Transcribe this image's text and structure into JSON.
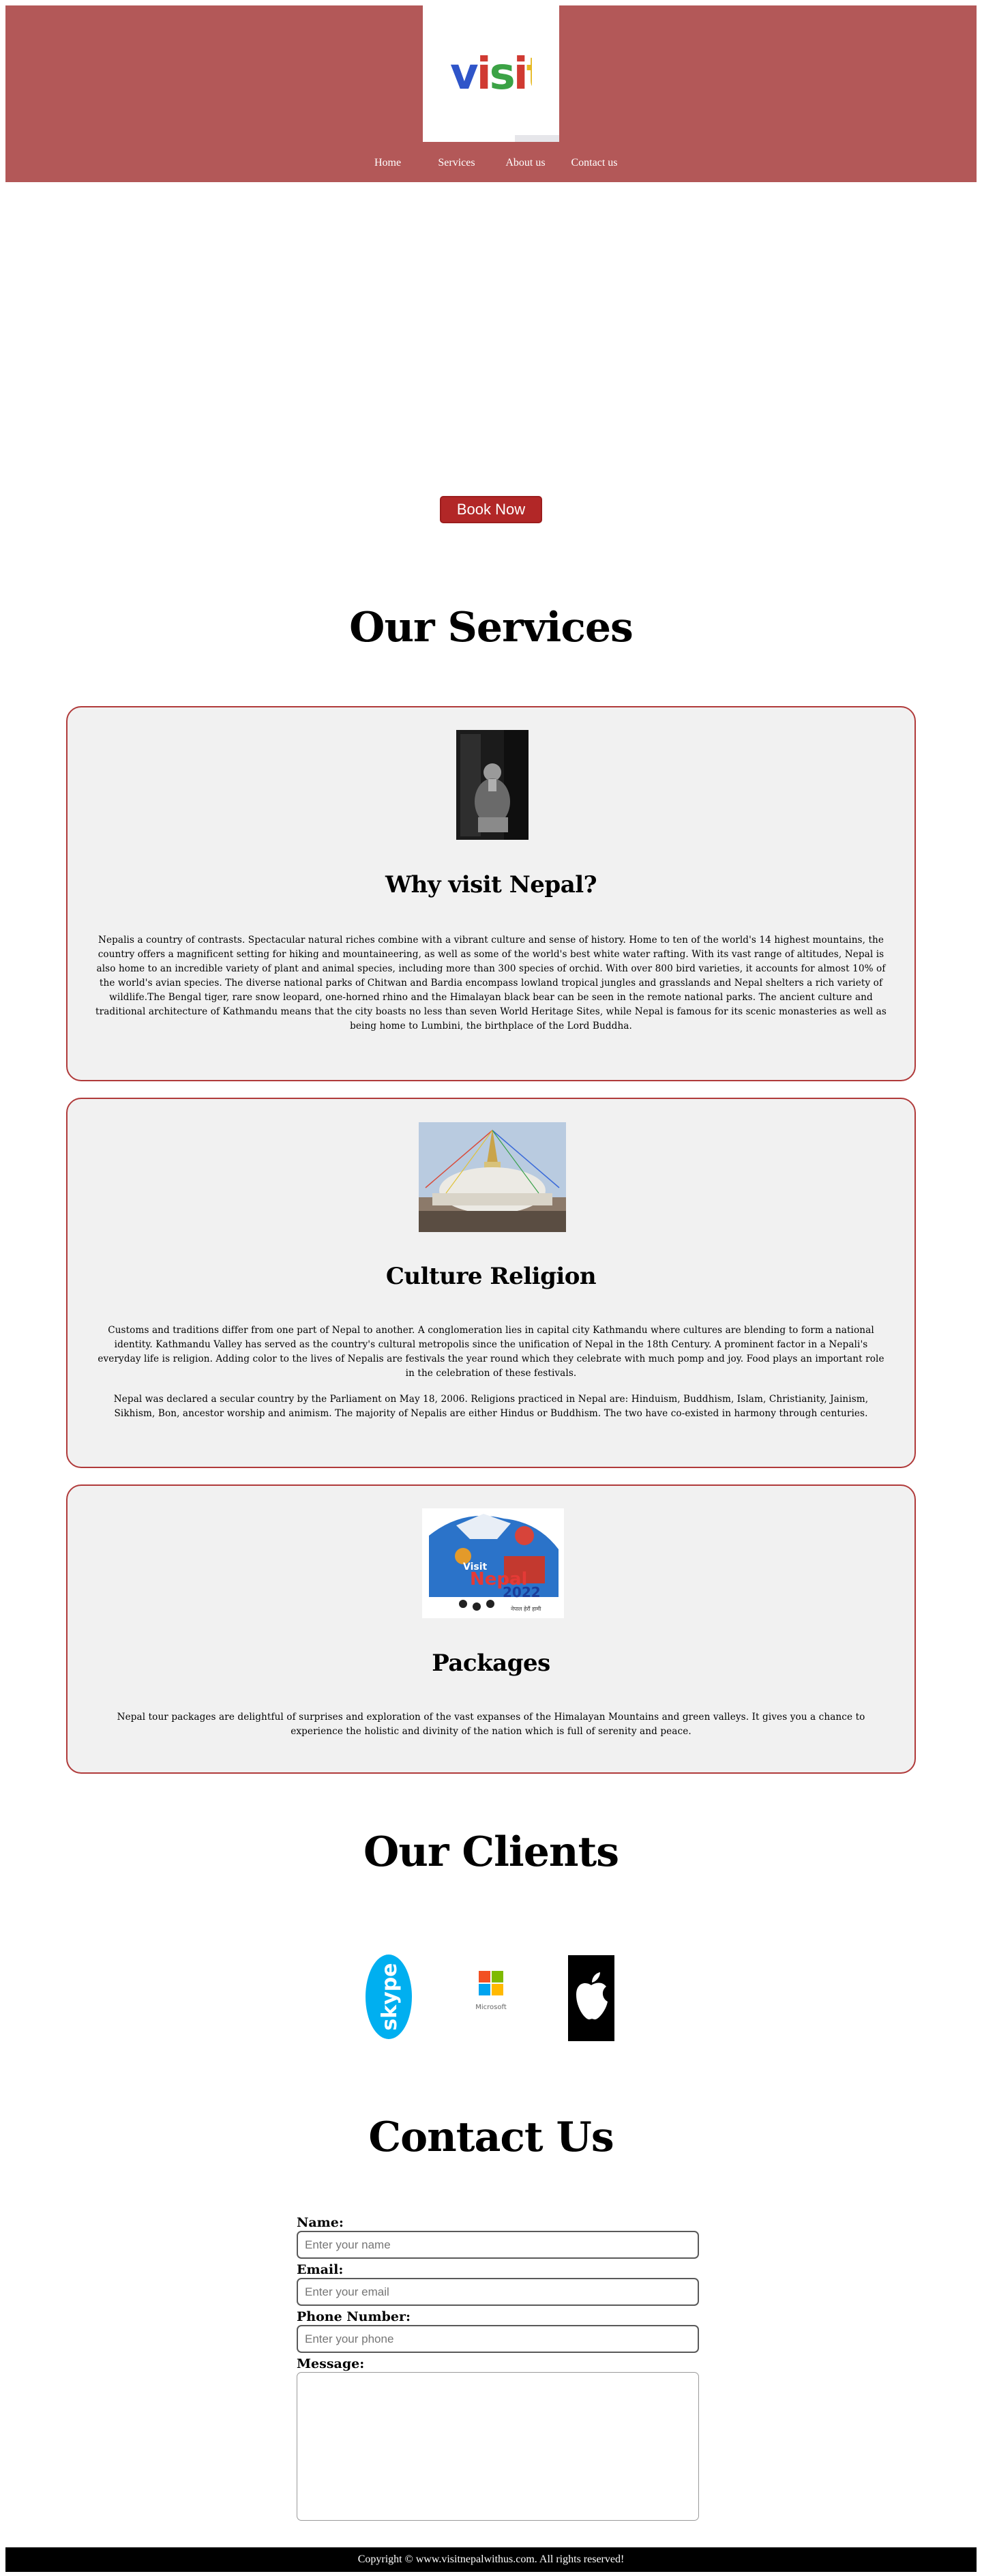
{
  "header": {
    "logo_text": "visit",
    "nav": [
      "Home",
      "Services",
      "About us",
      "Contact us"
    ]
  },
  "hero": {
    "book_label": "Book Now"
  },
  "services": {
    "title": "Our Services",
    "cards": [
      {
        "title": "Why visit Nepal?",
        "paragraphs": [
          "Nepalis a country of contrasts. Spectacular natural riches combine with a vibrant culture and sense of history. Home to ten of the world's 14 highest mountains, the country offers a magnificent setting for hiking and mountaineering, as well as some of the world's best white water rafting. With its vast range of altitudes, Nepal is also home to an incredible variety of plant and animal species, including more than 300 species of orchid. With over 800 bird varieties, it accounts for almost 10% of the world's avian species. The diverse national parks of Chitwan and Bardia encompass lowland tropical jungles and grasslands and Nepal shelters a rich variety of wildlife.The Bengal tiger, rare snow leopard, one-horned rhino and the Himalayan black bear can be seen in the remote national parks. The ancient culture and traditional architecture of Kathmandu means that the city boasts no less than seven World Heritage Sites, while Nepal is famous for its scenic monasteries as well as being home to Lumbini, the birthplace of the Lord Buddha."
        ]
      },
      {
        "title": "Culture Religion",
        "paragraphs": [
          "Customs and traditions differ from one part of Nepal to another. A conglomeration lies in capital city Kathmandu where cultures are blending to form a national identity. Kathmandu Valley has served as the country's cultural metropolis since the unification of Nepal in the 18th Century. A prominent factor in a Nepali's everyday life is religion. Adding color to the lives of Nepalis are festivals the year round which they celebrate with much pomp and joy. Food plays an important role in the celebration of these festivals.",
          "Nepal was declared a secular country by the Parliament on May 18, 2006. Religions practiced in Nepal are: Hinduism, Buddhism, Islam, Christianity, Jainism, Sikhism, Bon, ancestor worship and animism. The majority of Nepalis are either Hindus or Buddhism. The two have co-existed in harmony through centuries."
        ]
      },
      {
        "title": "Packages",
        "poster": {
          "top": "Visit",
          "middle": "Nepal",
          "year": "2022",
          "tagline": "नेपाल हेरौं हामी"
        },
        "paragraphs": [
          "Nepal tour packages are delightful of surprises and exploration of the vast expanses of the Himalayan Mountains and green valleys. It gives you a chance to experience the holistic and divinity of the nation which is full of serenity and peace."
        ]
      }
    ]
  },
  "clients": {
    "title": "Our Clients",
    "logos": [
      {
        "name": "skype-logo",
        "text": "skype",
        "color": "#00aff0"
      },
      {
        "name": "microsoft-logo",
        "text": "Microsoft",
        "colors": [
          "#f25022",
          "#7fba00",
          "#00a4ef",
          "#ffb900"
        ]
      },
      {
        "name": "apple-logo",
        "color": "#000000"
      }
    ]
  },
  "contact": {
    "title": "Contact Us",
    "name_label": "Name:",
    "name_placeholder": "Enter your name",
    "email_label": "Email:",
    "email_placeholder": "Enter your email",
    "phone_label": "Phone Number:",
    "phone_placeholder": "Enter your phone",
    "message_label": "Message:"
  },
  "footer": {
    "text": "Copyright © www.visitnepalwithus.com. All rights reserved!"
  },
  "colors": {
    "header_bg": "#b35858",
    "accent": "#b22727",
    "card_bg": "#f1f1f1",
    "card_border": "#b03a3a"
  }
}
